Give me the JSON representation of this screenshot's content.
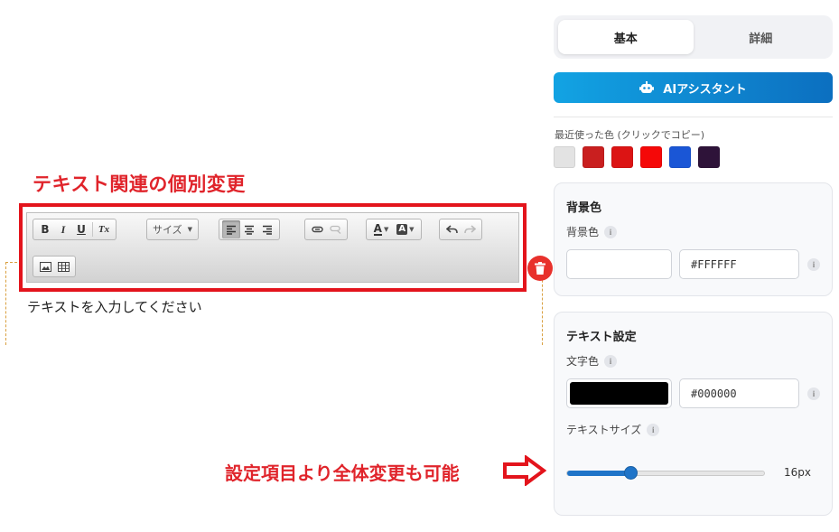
{
  "annotations": {
    "toolbar_note": "テキスト関連の個別変更",
    "settings_note": "設定項目より全体変更も可能"
  },
  "editor": {
    "toolbar": {
      "bold": "B",
      "italic": "I",
      "underline": "U",
      "clear_format": "Tx",
      "size_label": "サイズ",
      "text_color": "A",
      "bg_color": "A"
    },
    "placeholder_text": "テキストを入力してください"
  },
  "panel": {
    "tabs": [
      {
        "label": "基本",
        "active": true
      },
      {
        "label": "詳細",
        "active": false
      }
    ],
    "ai_button": "AIアシスタント",
    "recent_colors": {
      "label": "最近使った色 (クリックでコピー)",
      "colors": [
        "#e3e3e3",
        "#c91f1f",
        "#dc1414",
        "#f50808",
        "#1a56d6",
        "#2e1339"
      ]
    },
    "background": {
      "title": "背景色",
      "label": "背景色",
      "color": "#FFFFFF",
      "hex": "#FFFFFF"
    },
    "text_settings": {
      "title": "テキスト設定",
      "color_label": "文字色",
      "color": "#000000",
      "hex": "#000000",
      "size_label": "テキストサイズ",
      "size_fraction": 0.32,
      "size_value": "16px"
    },
    "accent_color": "#1f74c8"
  }
}
